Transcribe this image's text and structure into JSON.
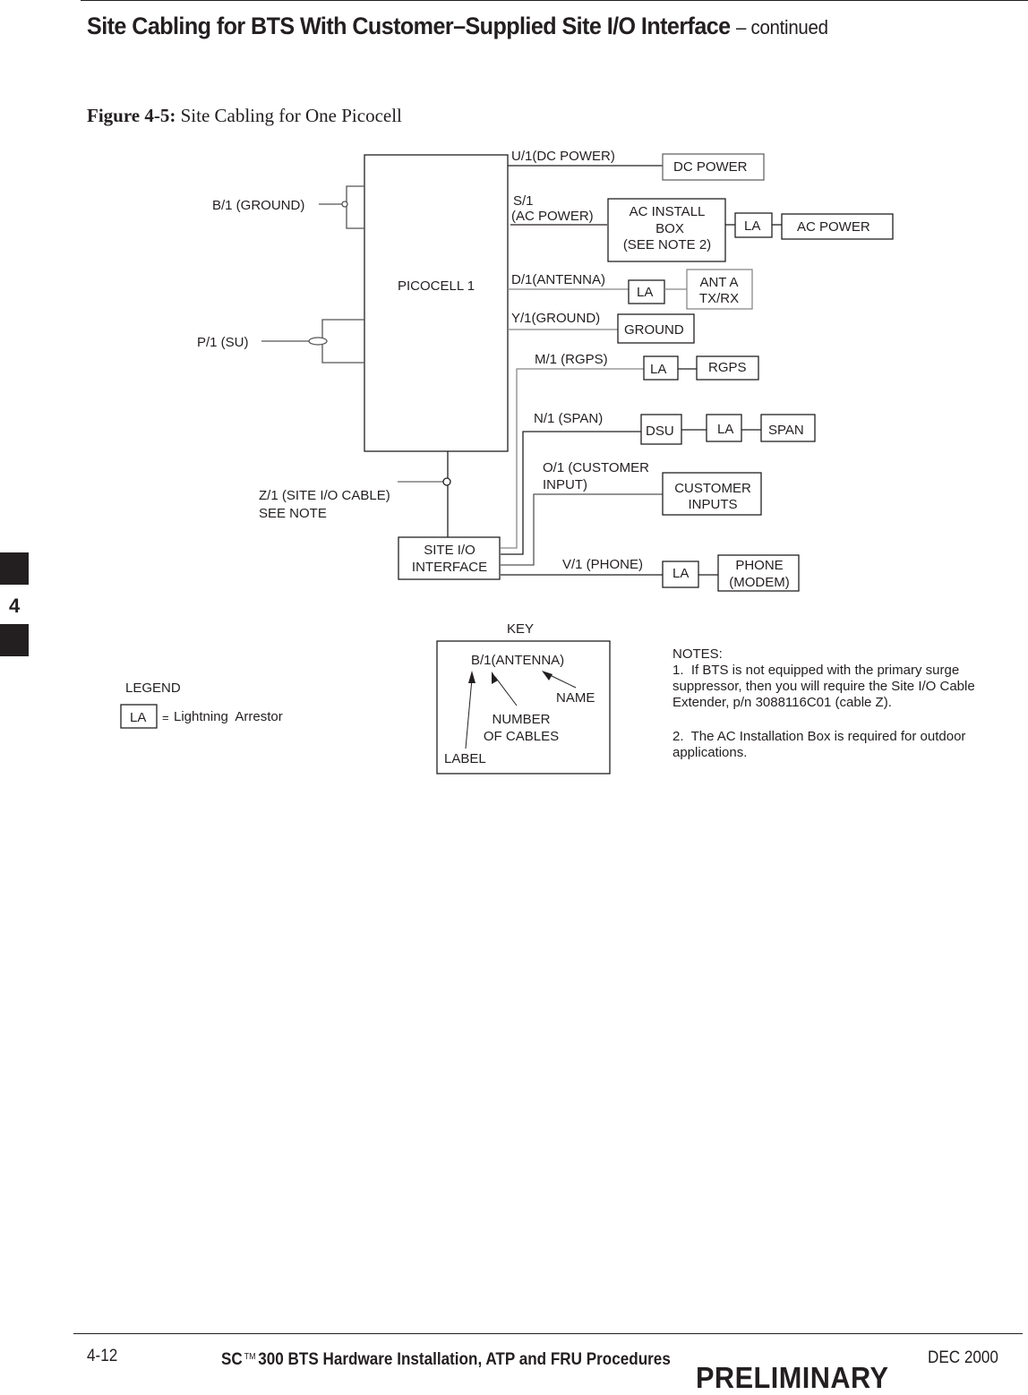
{
  "header": {
    "title": "Site Cabling for BTS With Customer–Supplied Site I/O Interface",
    "title_suffix": "– continued"
  },
  "figure": {
    "number": "Figure 4-5:",
    "caption": "Site Cabling for One Picocell"
  },
  "diagram": {
    "picocell_label": "PICOCELL 1",
    "left_cables": {
      "ground": "B/1 (GROUND)",
      "su": "P/1 (SU)"
    },
    "cables": {
      "dc_power": "U/1(DC POWER)",
      "ac_power_line1": "S/1",
      "ac_power_line2": "(AC POWER)",
      "antenna": "D/1(ANTENNA)",
      "ground": "Y/1(GROUND)",
      "rgps": "M/1 (RGPS)",
      "span": "N/1 (SPAN)",
      "customer_input_line1": "O/1 (CUSTOMER",
      "customer_input_line2": "INPUT)",
      "phone": "V/1 (PHONE)",
      "site_io_line1": "Z/1 (SITE I/O CABLE)",
      "site_io_line2": "SEE NOTE"
    },
    "boxes": {
      "dc_power": "DC POWER",
      "ac_install_line1": "AC INSTALL",
      "ac_install_line2": "BOX",
      "ac_install_line3": "(SEE NOTE 2)",
      "la": "LA",
      "ac_power": "AC POWER",
      "ant_line1": "ANT A",
      "ant_line2": "TX/RX",
      "ground": "GROUND",
      "rgps": "RGPS",
      "dsu": "DSU",
      "span": "SPAN",
      "customer_inputs_line1": "CUSTOMER",
      "customer_inputs_line2": "INPUTS",
      "site_io_line1": "SITE I/O",
      "site_io_line2": "INTERFACE",
      "phone_line1": "PHONE",
      "phone_line2": "(MODEM)"
    },
    "key": {
      "title": "KEY",
      "example": "B/1(ANTENNA)",
      "name": "NAME",
      "number_line1": "NUMBER",
      "number_line2": "OF CABLES",
      "label": "LABEL"
    },
    "legend": {
      "title": "LEGEND",
      "symbol": "LA",
      "equals": "=",
      "meaning": "Lightning  Arrestor"
    },
    "notes": {
      "title": "NOTES:",
      "note1_lines": [
        "1.  If BTS is not equipped with the primary surge",
        "suppressor, then you will require the Site I/O Cable",
        "Extender, p/n 3088116C01 (cable Z)."
      ],
      "note2_lines": [
        "2.  The AC Installation Box is required for outdoor",
        "applications."
      ]
    }
  },
  "side_tab": {
    "chapter": "4"
  },
  "footer": {
    "page_number": "4-12",
    "doc_title_prefix": "SC",
    "trademark": "TM",
    "doc_title": "300 BTS Hardware Installation, ATP and FRU Procedures",
    "date": "DEC 2000",
    "status": "PRELIMINARY"
  }
}
